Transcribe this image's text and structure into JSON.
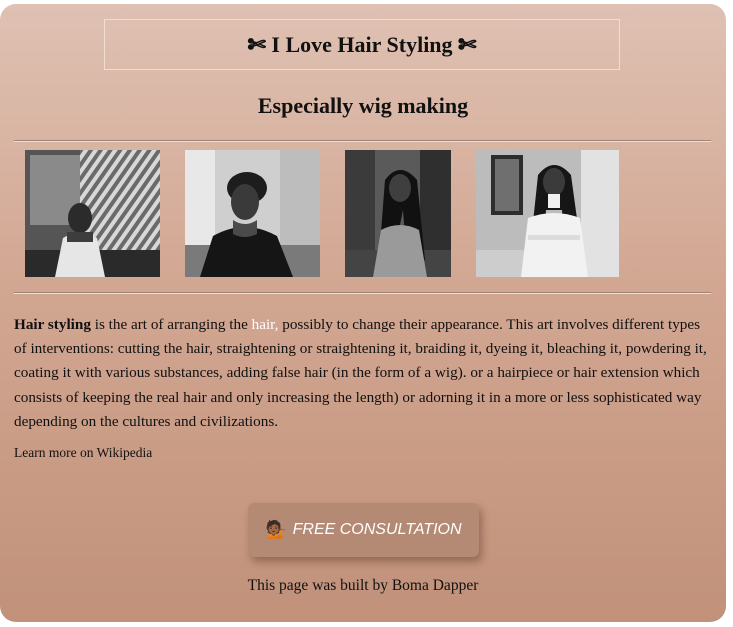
{
  "header": {
    "title": "✄ I Love Hair Styling ✄",
    "subtitle": "Especially wig making"
  },
  "gallery": {
    "images": [
      {
        "alt": "woman seated in front of patterned artwork"
      },
      {
        "alt": "woman in black dress looking to the side"
      },
      {
        "alt": "woman with long straight hair"
      },
      {
        "alt": "woman in fringed white top with long hair"
      }
    ]
  },
  "article": {
    "term": "Hair styling",
    "text_before_link": " is the art of arranging the ",
    "link_text": "hair,",
    "text_after_link": " possibly to change their appearance. This art involves different types of interventions: cutting the hair, straightening or straightening it, braiding it, dyeing it, bleaching it, powdering it, coating it with various substances, adding false hair (in the form of a wig). or a hairpiece or hair extension which consists of keeping the real hair and only increasing the length) or adorning it in a more or less sophisticated way depending on the cultures and civilizations.",
    "learn_more": "Learn more on Wikipedia"
  },
  "cta": {
    "emoji": "💁🏾",
    "label": "FREE CONSULTATION"
  },
  "footer": {
    "text": "This page was built by Boma Dapper"
  },
  "colors": {
    "gradient_top": "#dfc1b3",
    "gradient_bottom": "#c1917a",
    "button": "#b58a75",
    "link": "#ffffff"
  }
}
